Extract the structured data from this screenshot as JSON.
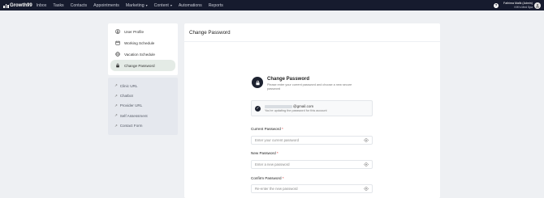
{
  "brand": {
    "name": "Growth99"
  },
  "nav": {
    "items": [
      {
        "label": "Inbox",
        "has_caret": false
      },
      {
        "label": "Tasks",
        "has_caret": false
      },
      {
        "label": "Contacts",
        "has_caret": false
      },
      {
        "label": "Appointments",
        "has_caret": false
      },
      {
        "label": "Marketing",
        "has_caret": true
      },
      {
        "label": "Content",
        "has_caret": true
      },
      {
        "label": "Automations",
        "has_caret": false
      },
      {
        "label": "Reports",
        "has_caret": false
      }
    ],
    "help_icon": "question-circle-icon"
  },
  "user": {
    "name": "Fathima Malik (Admin)",
    "company": "KHI's Med Spa",
    "avatar_icon": "user-icon"
  },
  "sidebar": {
    "items": [
      {
        "label": "User Profile",
        "icon": "user-circle-icon",
        "active": false
      },
      {
        "label": "Working Schedule",
        "icon": "calendar-icon",
        "active": false
      },
      {
        "label": "Vacation Schedule",
        "icon": "globe-icon",
        "active": false
      },
      {
        "label": "Change Password",
        "icon": "lock-icon",
        "active": true
      }
    ],
    "links": [
      {
        "label": "Clinic URL",
        "icon": "external-link-icon"
      },
      {
        "label": "Chatbot",
        "icon": "external-link-icon"
      },
      {
        "label": "Provider URL",
        "icon": "external-link-icon"
      },
      {
        "label": "Self Assessment",
        "icon": "external-link-icon"
      },
      {
        "label": "Contact Form",
        "icon": "external-link-icon"
      }
    ]
  },
  "main": {
    "header_title": "Change Password",
    "section_title": "Change Password",
    "section_desc": "Please enter your current password and choose a new secure password",
    "account": {
      "email_visible": "@gmail.com",
      "note": "You're updating the password for this account"
    },
    "fields": [
      {
        "label": "Current Password",
        "required_mark": "*",
        "placeholder": "Enter your current password"
      },
      {
        "label": "New Password",
        "required_mark": "*",
        "placeholder": "Enter a new password"
      },
      {
        "label": "Confirm Password",
        "required_mark": "*",
        "placeholder": "Re-enter the new password"
      }
    ]
  },
  "colors": {
    "topbar": "#161b2e",
    "active_item_bg": "#e4ebe6",
    "lock_badge": "#1d2230",
    "required": "#dd3333"
  }
}
